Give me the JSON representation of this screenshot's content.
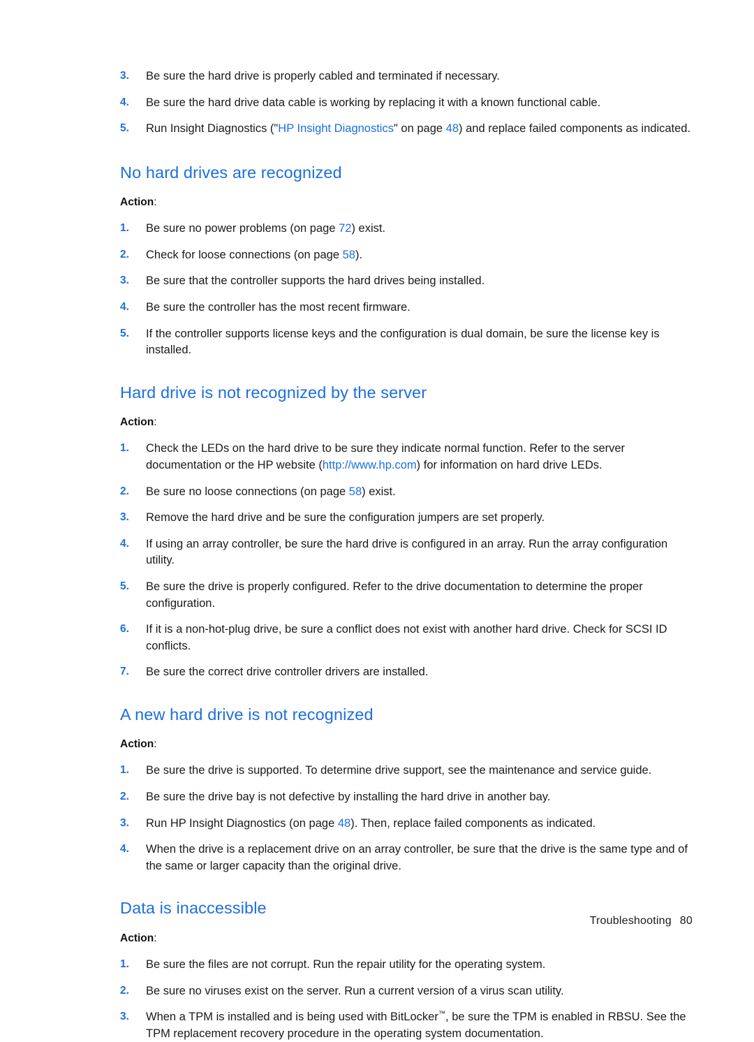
{
  "document": {
    "footer": {
      "chapter": "Troubleshooting",
      "page_number": "80"
    },
    "action_label": "Action",
    "action_colon": ":"
  },
  "top_list": {
    "items": [
      {
        "num": "3.",
        "parts": [
          {
            "type": "text",
            "value": "Be sure the hard drive is properly cabled and terminated if necessary."
          }
        ]
      },
      {
        "num": "4.",
        "parts": [
          {
            "type": "text",
            "value": "Be sure the hard drive data cable is working by replacing it with a known functional cable."
          }
        ]
      },
      {
        "num": "5.",
        "parts": [
          {
            "type": "text",
            "value": "Run Insight Diagnostics (\""
          },
          {
            "type": "link",
            "value": "HP Insight Diagnostics"
          },
          {
            "type": "text",
            "value": "\" on page "
          },
          {
            "type": "pagenum",
            "value": "48"
          },
          {
            "type": "text",
            "value": ") and replace failed components as indicated."
          }
        ]
      }
    ]
  },
  "sections": [
    {
      "heading": "No hard drives are recognized",
      "items": [
        {
          "num": "1.",
          "parts": [
            {
              "type": "text",
              "value": "Be sure no power problems (on page "
            },
            {
              "type": "pagenum",
              "value": "72"
            },
            {
              "type": "text",
              "value": ") exist."
            }
          ]
        },
        {
          "num": "2.",
          "parts": [
            {
              "type": "text",
              "value": "Check for loose connections (on page "
            },
            {
              "type": "pagenum",
              "value": "58"
            },
            {
              "type": "text",
              "value": ")."
            }
          ]
        },
        {
          "num": "3.",
          "parts": [
            {
              "type": "text",
              "value": "Be sure that the controller supports the hard drives being installed."
            }
          ]
        },
        {
          "num": "4.",
          "parts": [
            {
              "type": "text",
              "value": "Be sure the controller has the most recent firmware."
            }
          ]
        },
        {
          "num": "5.",
          "parts": [
            {
              "type": "text",
              "value": "If the controller supports license keys and the configuration is dual domain, be sure the license key is installed."
            }
          ]
        }
      ]
    },
    {
      "heading": "Hard drive is not recognized by the server",
      "items": [
        {
          "num": "1.",
          "parts": [
            {
              "type": "text",
              "value": "Check the LEDs on the hard drive to be sure they indicate normal function. Refer to the server documentation or the HP website ("
            },
            {
              "type": "link",
              "value": "http://www.hp.com"
            },
            {
              "type": "text",
              "value": ") for information on hard drive LEDs."
            }
          ]
        },
        {
          "num": "2.",
          "parts": [
            {
              "type": "text",
              "value": "Be sure no loose connections (on page "
            },
            {
              "type": "pagenum",
              "value": "58"
            },
            {
              "type": "text",
              "value": ") exist."
            }
          ]
        },
        {
          "num": "3.",
          "parts": [
            {
              "type": "text",
              "value": "Remove the hard drive and be sure the configuration jumpers are set properly."
            }
          ]
        },
        {
          "num": "4.",
          "parts": [
            {
              "type": "text",
              "value": "If using an array controller, be sure the hard drive is configured in an array. Run the array configuration utility."
            }
          ]
        },
        {
          "num": "5.",
          "parts": [
            {
              "type": "text",
              "value": "Be sure the drive is properly configured. Refer to the drive documentation to determine the proper configuration."
            }
          ]
        },
        {
          "num": "6.",
          "parts": [
            {
              "type": "text",
              "value": "If it is a non-hot-plug drive, be sure a conflict does not exist with another hard drive. Check for SCSI ID conflicts."
            }
          ]
        },
        {
          "num": "7.",
          "parts": [
            {
              "type": "text",
              "value": "Be sure the correct drive controller drivers are installed."
            }
          ]
        }
      ]
    },
    {
      "heading": "A new hard drive is not recognized",
      "items": [
        {
          "num": "1.",
          "parts": [
            {
              "type": "text",
              "value": "Be sure the drive is supported. To determine drive support, see the maintenance and service guide."
            }
          ]
        },
        {
          "num": "2.",
          "parts": [
            {
              "type": "text",
              "value": "Be sure the drive bay is not defective by installing the hard drive in another bay."
            }
          ]
        },
        {
          "num": "3.",
          "parts": [
            {
              "type": "text",
              "value": "Run HP Insight Diagnostics (on page "
            },
            {
              "type": "pagenum",
              "value": "48"
            },
            {
              "type": "text",
              "value": "). Then, replace failed components as indicated."
            }
          ]
        },
        {
          "num": "4.",
          "parts": [
            {
              "type": "text",
              "value": "When the drive is a replacement drive on an array controller, be sure that the drive is the same type and of the same or larger capacity than the original drive."
            }
          ]
        }
      ]
    },
    {
      "heading": "Data is inaccessible",
      "items": [
        {
          "num": "1.",
          "parts": [
            {
              "type": "text",
              "value": "Be sure the files are not corrupt. Run the repair utility for the operating system."
            }
          ]
        },
        {
          "num": "2.",
          "parts": [
            {
              "type": "text",
              "value": "Be sure no viruses exist on the server. Run a current version of a virus scan utility."
            }
          ]
        },
        {
          "num": "3.",
          "parts": [
            {
              "type": "text",
              "value": "When a TPM is installed and is being used with BitLocker"
            },
            {
              "type": "trademark",
              "value": "™"
            },
            {
              "type": "text",
              "value": ", be sure the TPM is enabled in RBSU. See the TPM replacement recovery procedure in the operating system documentation."
            }
          ]
        }
      ]
    }
  ],
  "colors": {
    "heading_blue": "#1c6fe0",
    "link_blue": "#1c6fe0",
    "body_black": "#1a1a1a"
  }
}
